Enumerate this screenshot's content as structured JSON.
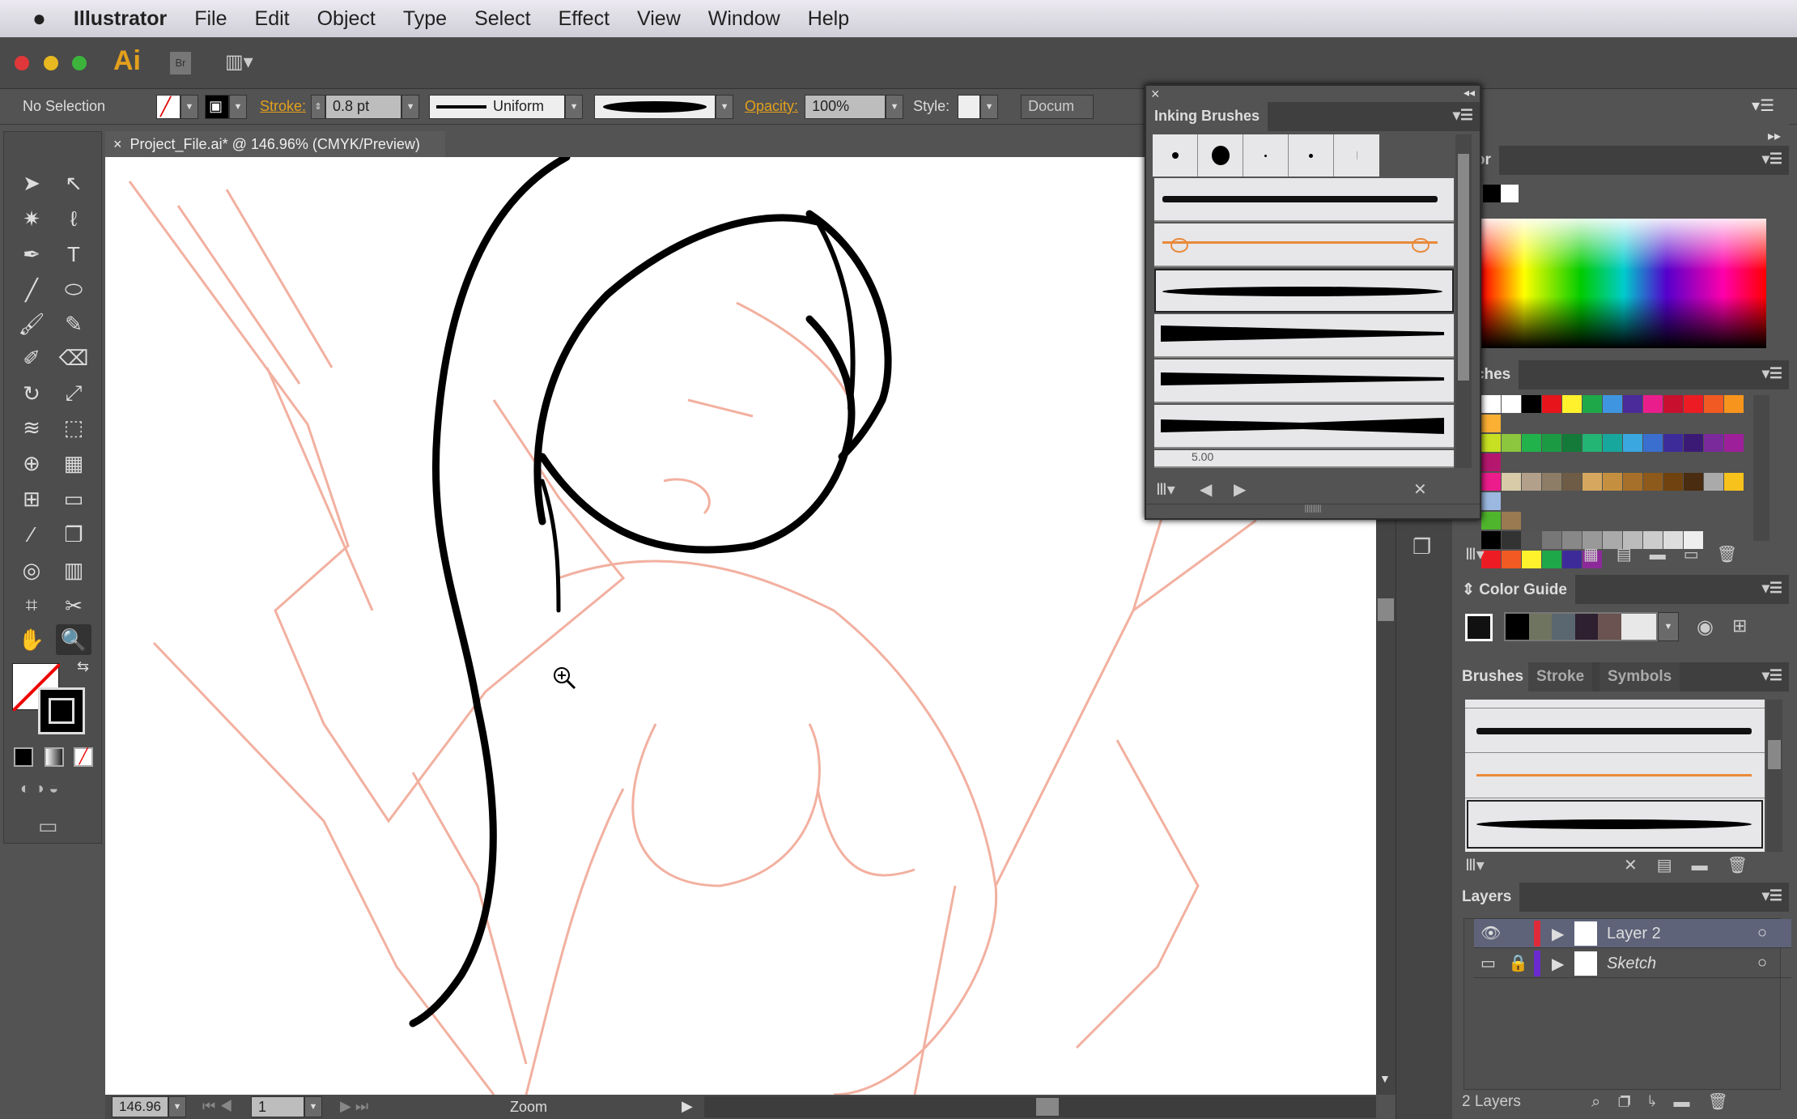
{
  "menubar": {
    "apple": "apple-logo",
    "app": "Illustrator",
    "items": [
      "File",
      "Edit",
      "Object",
      "Type",
      "Select",
      "Effect",
      "View",
      "Window",
      "Help"
    ]
  },
  "appbar": {
    "logo": "Ai",
    "bridge": "Br"
  },
  "control": {
    "selection": "No Selection",
    "stroke_label": "Stroke:",
    "stroke_value": "0.8 pt",
    "profile": "Uniform",
    "opacity_label": "Opacity:",
    "opacity_value": "100%",
    "style_label": "Style:",
    "document_button": "Docum"
  },
  "document": {
    "tab": "Project_File.ai* @ 146.96% (CMYK/Preview)"
  },
  "status": {
    "zoom": "146.96",
    "page": "1",
    "tool": "Zoom"
  },
  "inking_panel": {
    "title": "Inking Brushes",
    "partial_label": "5.00"
  },
  "color_panel": {
    "title": "olor"
  },
  "swatches_panel": {
    "title": "atches",
    "rows": [
      [
        "#ffffff",
        "#ffffff",
        "#000000",
        "#e8141c",
        "#fff22c",
        "#1fa84a",
        "#3f95e0",
        "#4b2a9a",
        "#e91e8c",
        "#c8102e",
        "#ed1c24",
        "#f15a22",
        "#f7941d",
        "#fbb034"
      ],
      [
        "#c7e022",
        "#8cc63f",
        "#22b24c",
        "#1c9a43",
        "#137a3a",
        "#22b573",
        "#17a79d",
        "#3aa7e0",
        "#3a6fd0",
        "#3e2b9a",
        "#3b1a75",
        "#7a2a9a",
        "#9e1f9a",
        "#b5176e"
      ],
      [
        "#ec1c8c",
        "#d7cba8",
        "#b3a08a",
        "#8e7d66",
        "#6e5c47",
        "#d6a85f",
        "#c49040",
        "#a6702a",
        "#8d5a1c",
        "#6f4210",
        "#4a2c10",
        "#aaaaaa",
        "#f7c21c",
        "#9bb8e0"
      ],
      [
        "#4fb52c",
        "#9a7a50"
      ],
      [
        "#000000",
        "#333333",
        "#555555",
        "#777777",
        "#888888",
        "#999999",
        "#aaaaaa",
        "#bbbbbb",
        "#cccccc",
        "#dddddd",
        "#eeeeee"
      ],
      [
        "#ed1c24",
        "#f15a22",
        "#fff22c",
        "#1fa84a",
        "#3e2b9a",
        "#8d2a9a"
      ]
    ]
  },
  "color_guide": {
    "title": "Color Guide",
    "colors": [
      "#000000",
      "#6f7460",
      "#5a6670",
      "#2e2030",
      "#6a5350",
      "#e8e8e8"
    ]
  },
  "brushes_panel": {
    "tabs": [
      "Brushes",
      "Stroke",
      "Symbols"
    ]
  },
  "layers_panel": {
    "title": "Layers",
    "layers": [
      {
        "name": "Layer 2",
        "color": "#e02a3a"
      },
      {
        "name": "Sketch",
        "color": "#6a2ad0"
      }
    ],
    "count": "2 Layers"
  },
  "colors": {
    "accent": "#e3a01c",
    "sketch": "#f0a890",
    "ink": "#000000"
  }
}
